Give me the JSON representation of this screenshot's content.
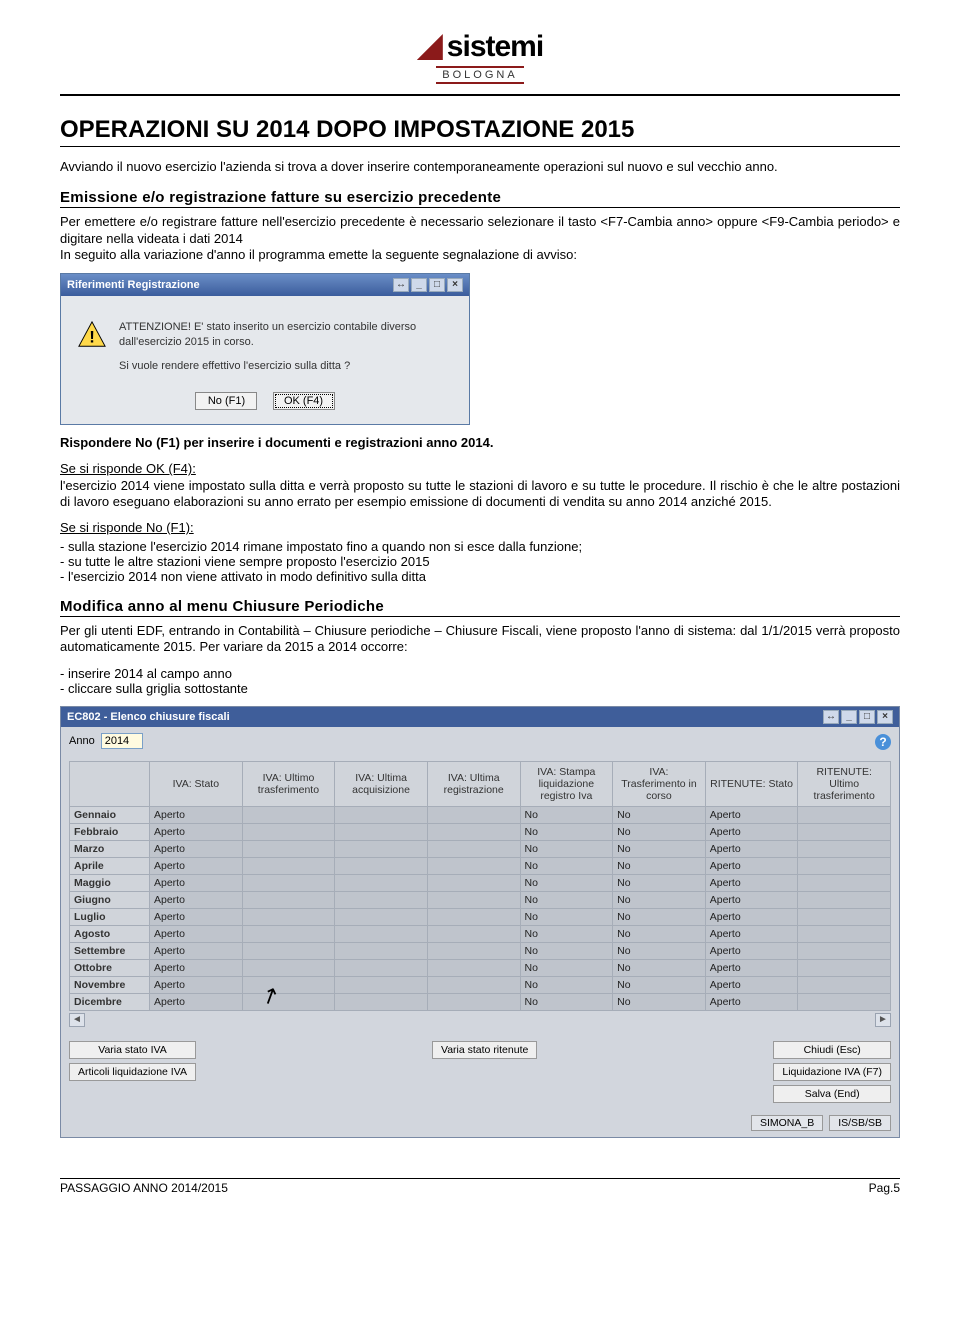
{
  "logo": {
    "text": "sistemi",
    "sub": "BOLOGNA"
  },
  "h1": "OPERAZIONI SU 2014 DOPO IMPOSTAZIONE 2015",
  "intro": "Avviando il nuovo esercizio l'azienda si trova a dover inserire contemporaneamente operazioni sul nuovo e sul vecchio anno.",
  "sec1_head": "Emissione e/o registrazione fatture su esercizio precedente",
  "sec1_body": "Per emettere e/o registrare fatture nell'esercizio precedente è necessario selezionare il tasto <F7-Cambia anno> oppure <F9-Cambia periodo> e digitare nella videata i dati 2014\nIn seguito alla variazione d'anno il programma emette la seguente segnalazione di avviso:",
  "dialog": {
    "title": "Riferimenti Registrazione",
    "msg_line1": "ATTENZIONE! E' stato inserito un esercizio contabile diverso dall'esercizio 2015 in corso.",
    "msg_line2": "Si vuole rendere effettivo l'esercizio sulla ditta ?",
    "btn_no": "No (F1)",
    "btn_ok": "OK (F4)"
  },
  "after_dlg_bold": "Rispondere No (F1) per  inserire i documenti e registrazioni anno 2014.",
  "resp_ok_head": "Se si risponde  OK (F4):",
  "resp_ok_body": "l'esercizio 2014 viene impostato sulla ditta e verrà proposto su tutte le stazioni di lavoro e su tutte le procedure. Il rischio è che le altre postazioni di lavoro eseguano elaborazioni su anno  errato per esempio emissione di documenti di vendita su anno 2014 anziché 2015.",
  "resp_no_head": "Se si risponde No (F1):",
  "resp_no_items": [
    "sulla stazione l'esercizio 2014 rimane impostato fino a quando non si esce dalla funzione;",
    "su tutte le altre stazioni viene sempre proposto l'esercizio 2015",
    "l'esercizio 2014 non viene attivato in modo definitivo sulla ditta"
  ],
  "sec2_head": "Modifica anno al menu Chiusure Periodiche",
  "sec2_body": "Per gli utenti EDF, entrando in Contabilità – Chiusure periodiche – Chiusure Fiscali, viene proposto l'anno di sistema: dal 1/1/2015 verrà proposto automaticamente 2015. Per variare da 2015 a 2014 occorre:",
  "sec2_items": [
    "inserire 2014 al campo anno",
    "cliccare sulla griglia sottostante"
  ],
  "window": {
    "title": "EC802 - Elenco chiusure fiscali",
    "anno_label": "Anno",
    "anno_value": "2014",
    "headers": [
      "",
      "IVA: Stato",
      "IVA: Ultimo trasferimento",
      "IVA: Ultima acquisizione",
      "IVA: Ultima registrazione",
      "IVA: Stampa liquidazione registro Iva",
      "IVA: Trasferimento in corso",
      "RITENUTE: Stato",
      "RITENUTE: Ultimo trasferimento"
    ],
    "months": [
      "Gennaio",
      "Febbraio",
      "Marzo",
      "Aprile",
      "Maggio",
      "Giugno",
      "Luglio",
      "Agosto",
      "Settembre",
      "Ottobre",
      "Novembre",
      "Dicembre"
    ],
    "row_vals": [
      "Aperto",
      "",
      "",
      "",
      "No",
      "No",
      "Aperto",
      ""
    ],
    "btn_varia_iva": "Varia stato IVA",
    "btn_art_liq": "Articoli liquidazione IVA",
    "btn_varia_rit": "Varia stato ritenute",
    "btn_chiudi": "Chiudi (Esc)",
    "btn_liq": "Liquidazione IVA (F7)",
    "btn_salva": "Salva (End)",
    "status1": "SIMONA_B",
    "status2": "IS/SB/SB"
  },
  "footer": {
    "left": "PASSAGGIO ANNO 2014/2015",
    "right": "Pag.5"
  }
}
